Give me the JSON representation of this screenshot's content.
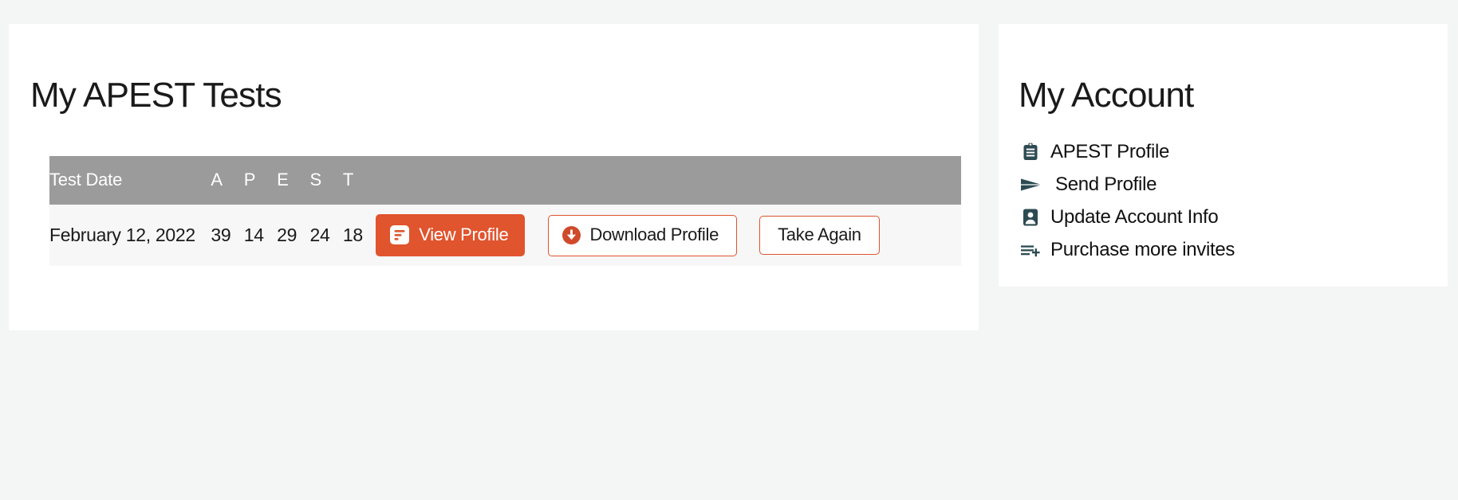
{
  "theme": {
    "page_background": "#f4f5f5",
    "card_background": "#ffffff",
    "accent": "#e0542e",
    "table_header_background": "#9b9b9b",
    "table_row_background": "#f7f7f7",
    "icon_color": "#2c4a52",
    "text_color": "#1a1a1a"
  },
  "tests_card": {
    "title": "My APEST Tests",
    "table": {
      "columns": [
        "Test Date",
        "A",
        "P",
        "E",
        "S",
        "T"
      ],
      "rows": [
        {
          "date": "February 12, 2022",
          "a": "39",
          "p": "14",
          "e": "29",
          "s": "24",
          "t": "18",
          "actions": {
            "view_profile": "View Profile",
            "view_profile_icon": "document-lines-icon",
            "download_profile": "Download Profile",
            "download_profile_icon": "download-circle-icon",
            "take_again": "Take Again"
          }
        }
      ]
    }
  },
  "account_card": {
    "title": "My Account",
    "items": [
      {
        "label": "APEST Profile",
        "icon": "clipboard-icon"
      },
      {
        "label": "Send Profile",
        "icon": "send-paper-plane-icon"
      },
      {
        "label": "Update Account Info",
        "icon": "contact-card-icon"
      },
      {
        "label": "Purchase more invites",
        "icon": "list-plus-icon"
      }
    ]
  }
}
